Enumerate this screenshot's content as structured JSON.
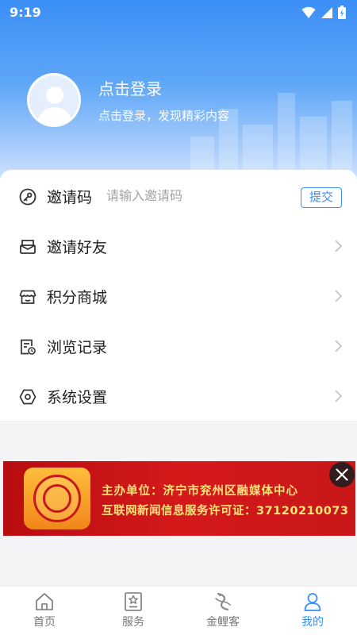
{
  "status_bar": {
    "time": "9:19"
  },
  "profile": {
    "title": "点击登录",
    "subtitle": "点击登录，发现精彩内容"
  },
  "invite": {
    "label": "邀请码",
    "placeholder": "请输入邀请码",
    "submit_label": "提交",
    "icon": "key-icon"
  },
  "menu": {
    "items": [
      {
        "label": "邀请好友",
        "icon": "envelope-icon"
      },
      {
        "label": "积分商城",
        "icon": "store-icon"
      },
      {
        "label": "浏览记录",
        "icon": "history-icon"
      },
      {
        "label": "系统设置",
        "icon": "settings-icon"
      }
    ]
  },
  "banner": {
    "line1": "主办单位：济宁市兖州区融媒体中心",
    "line2": "互联网新闻信息服务许可证：37120210073"
  },
  "tabs": [
    {
      "label": "首页",
      "icon": "home-icon",
      "active": false
    },
    {
      "label": "服务",
      "icon": "bookmark-star-icon",
      "active": false
    },
    {
      "label": "金鲤客",
      "icon": "carp-logo-icon",
      "active": false
    },
    {
      "label": "我的",
      "icon": "user-icon",
      "active": true
    }
  ],
  "colors": {
    "accent": "#3b8ff6",
    "banner_red": "#c8181b",
    "banner_text": "#ffe27a"
  }
}
